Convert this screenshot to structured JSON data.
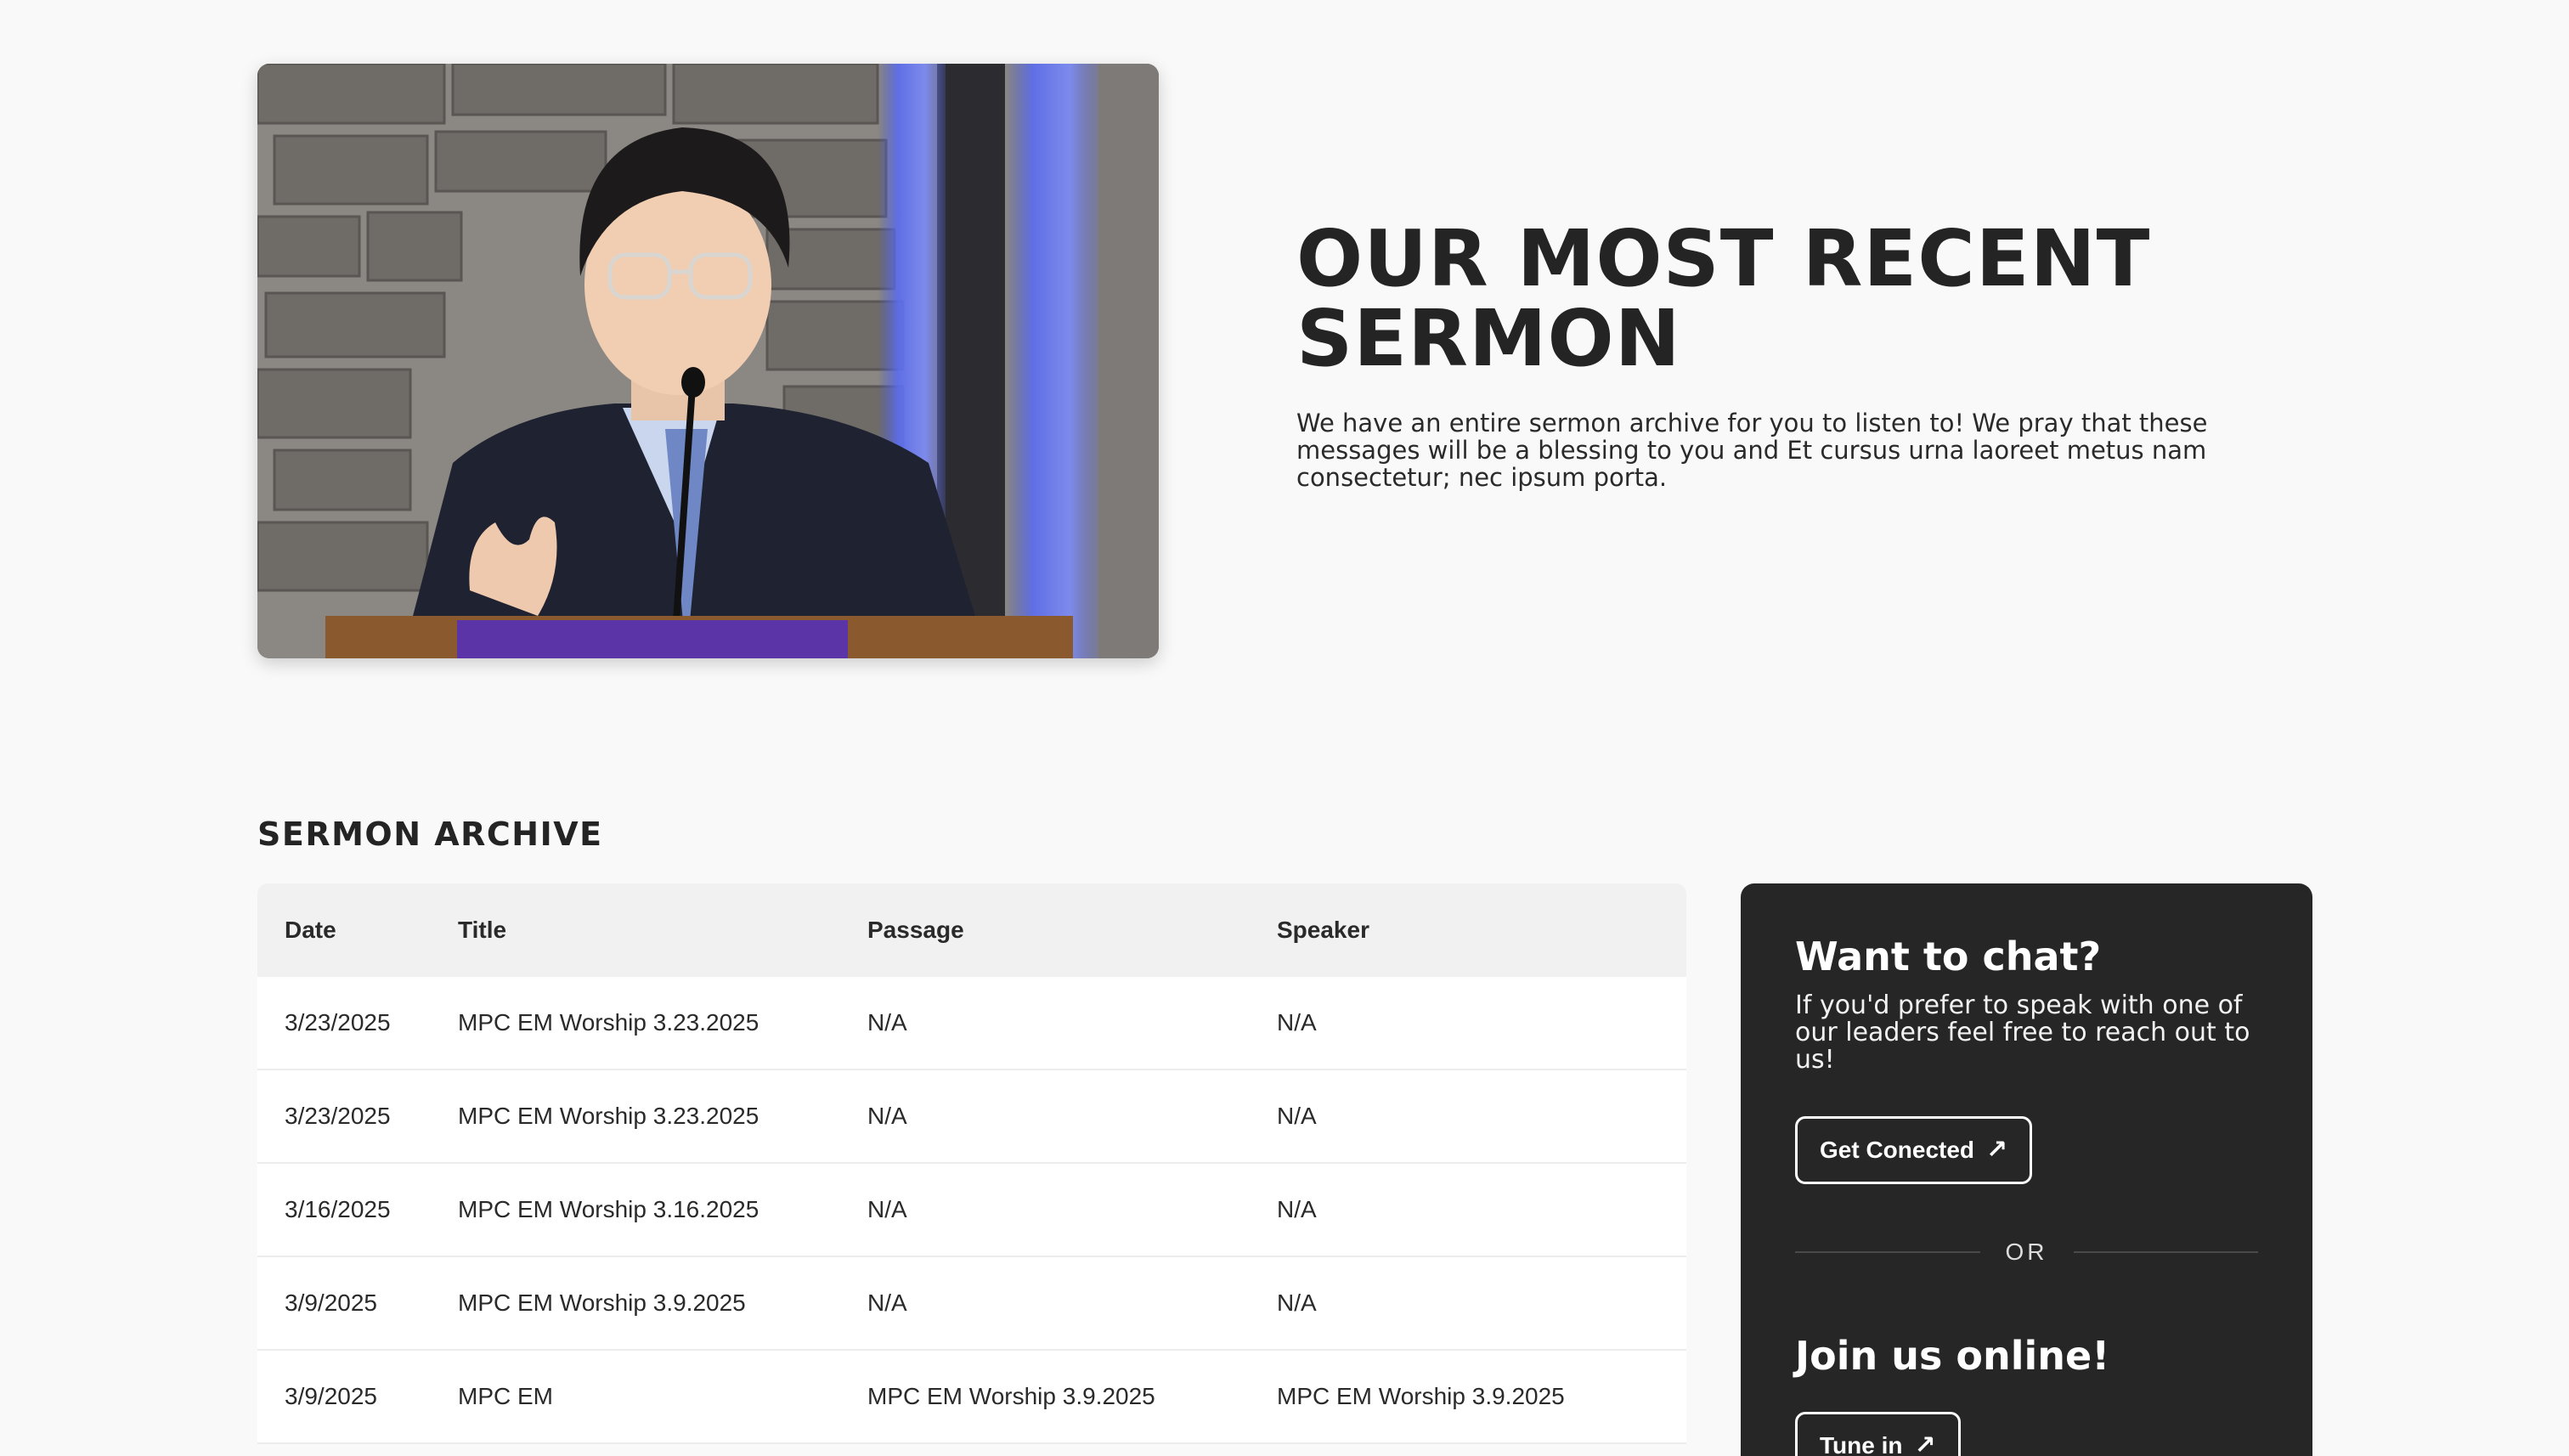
{
  "hero": {
    "title": "OUR MOST RECENT SERMON",
    "description": "We have an entire sermon archive for you to listen to! We pray that these messages will be a blessing to you and Et cursus urna laoreet metus nam consectetur; nec ipsum porta."
  },
  "archive": {
    "heading": "SERMON ARCHIVE",
    "columns": [
      "Date",
      "Title",
      "Passage",
      "Speaker"
    ],
    "rows": [
      [
        "3/23/2025",
        "MPC EM Worship 3.23.2025",
        "N/A",
        "N/A"
      ],
      [
        "3/23/2025",
        "MPC EM Worship 3.23.2025",
        "N/A",
        "N/A"
      ],
      [
        "3/16/2025",
        "MPC EM Worship 3.16.2025",
        "N/A",
        "N/A"
      ],
      [
        "3/9/2025",
        "MPC EM Worship 3.9.2025",
        "N/A",
        "N/A"
      ],
      [
        "3/9/2025",
        "MPC EM",
        "MPC EM Worship 3.9.2025",
        "MPC EM Worship 3.9.2025"
      ]
    ]
  },
  "card": {
    "chat_title": "Want to chat?",
    "chat_text": "If you'd prefer to speak with one of our leaders feel free to reach out to us!",
    "connect_label": "Get Conected",
    "or_label": "OR",
    "join_title": "Join us online!",
    "tune_label": "Tune in",
    "arrow_icon": "arrow-up-right-icon"
  }
}
